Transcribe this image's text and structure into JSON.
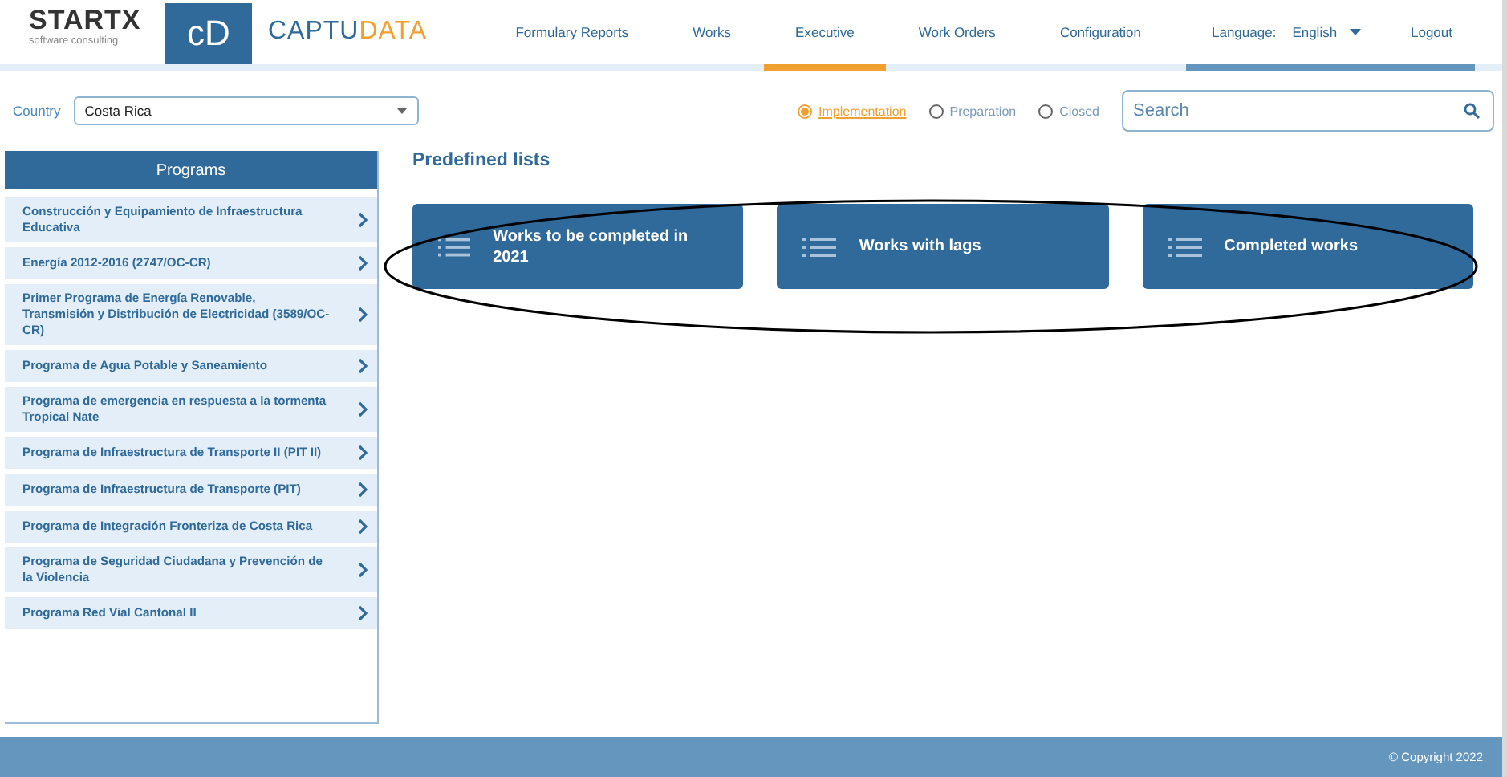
{
  "header": {
    "brand": {
      "name": "STARTX",
      "tagline": "software consulting"
    },
    "app_logo": {
      "mark": "cD",
      "name_part1": "CAPTU",
      "name_part2": "DATA"
    },
    "nav": [
      {
        "label": "Formulary Reports",
        "selected": false
      },
      {
        "label": "Works",
        "selected": false
      },
      {
        "label": "Executive",
        "selected": true
      },
      {
        "label": "Work Orders",
        "selected": false
      },
      {
        "label": "Configuration",
        "selected": false
      }
    ],
    "language": {
      "label": "Language:",
      "value": "English"
    },
    "logout": "Logout"
  },
  "country": {
    "label": "Country",
    "value": "Costa Rica"
  },
  "status_filter": [
    {
      "label": "Implementation",
      "selected": true
    },
    {
      "label": "Preparation",
      "selected": false
    },
    {
      "label": "Closed",
      "selected": false
    }
  ],
  "search": {
    "placeholder": "Search"
  },
  "sidebar": {
    "title": "Programs",
    "items": [
      {
        "label": "Construcción y Equipamiento de Infraestructura Educativa"
      },
      {
        "label": "Energía 2012-2016 (2747/OC-CR)"
      },
      {
        "label": "Primer Programa de Energía Renovable, Transmisión y Distribución de Electricidad (3589/OC-CR)"
      },
      {
        "label": "Programa de Agua Potable y Saneamiento"
      },
      {
        "label": "Programa de emergencia en respuesta a la tormenta Tropical Nate"
      },
      {
        "label": "Programa de Infraestructura de Transporte II (PIT II)"
      },
      {
        "label": "Programa de Infraestructura de Transporte (PIT)"
      },
      {
        "label": "Programa de Integración Fronteriza de Costa Rica"
      },
      {
        "label": "Programa de Seguridad Ciudadana y Prevención de la Violencia"
      },
      {
        "label": "Programa Red Vial Cantonal II"
      }
    ]
  },
  "predefined_lists": {
    "title": "Predefined lists",
    "items": [
      {
        "label": "Works to be completed in 2021"
      },
      {
        "label": "Works with lags"
      },
      {
        "label": "Completed works"
      }
    ]
  },
  "footer": {
    "copyright": "© Copyright 2022"
  }
}
